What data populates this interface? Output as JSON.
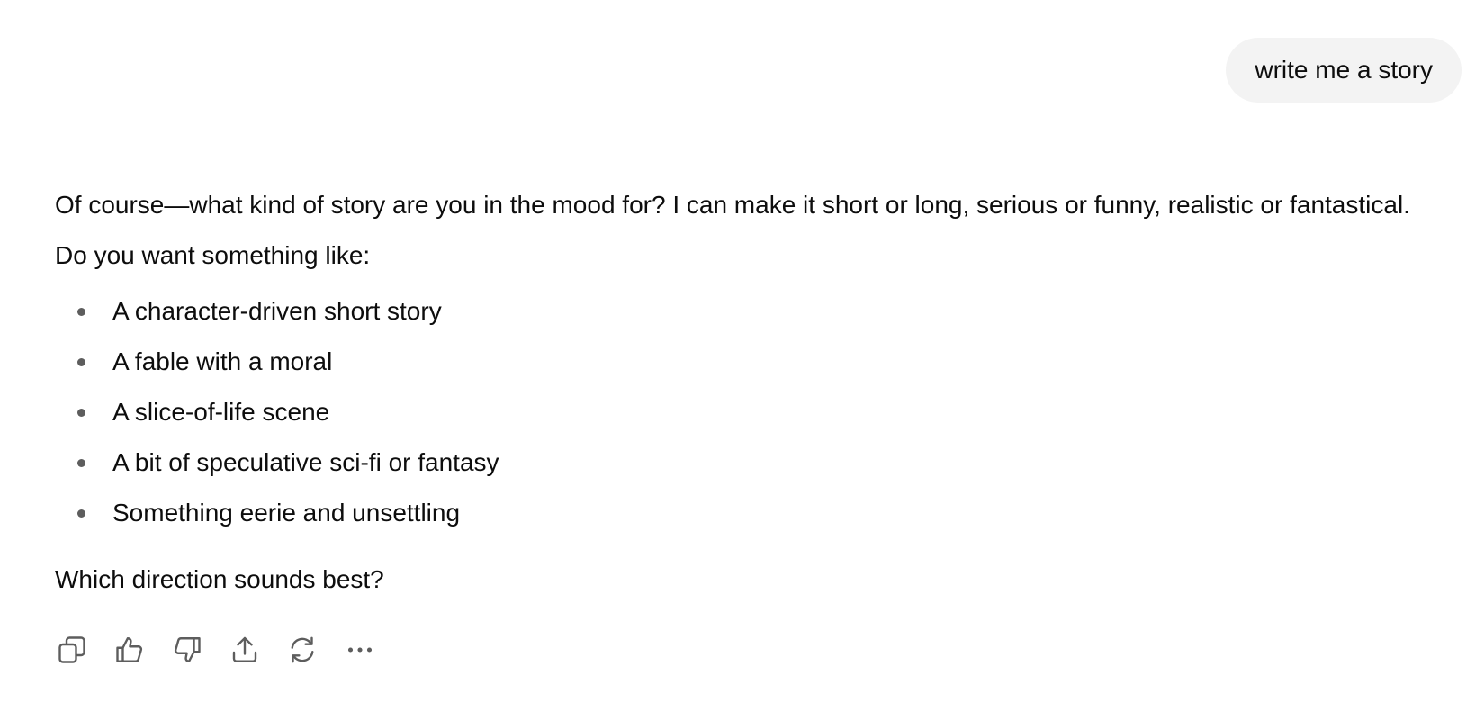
{
  "conversation": {
    "user_message": "write me a story",
    "assistant": {
      "intro": "Of course—what kind of story are you in the mood for? I can make it short or long, serious or funny, realistic or fantastical. Do you want something like:",
      "options": [
        "A character-driven short story",
        "A fable with a moral",
        "A slice-of-life scene",
        "A bit of speculative sci-fi or fantasy",
        "Something eerie and unsettling"
      ],
      "closing": "Which direction sounds best?"
    }
  },
  "actions": {
    "icons": [
      "copy-icon",
      "thumbs-up-icon",
      "thumbs-down-icon",
      "share-icon",
      "regenerate-icon",
      "more-icon"
    ]
  },
  "colors": {
    "user_bubble_bg": "#f3f3f3",
    "text": "#0d0d0d",
    "icon": "#5d5d5d"
  }
}
